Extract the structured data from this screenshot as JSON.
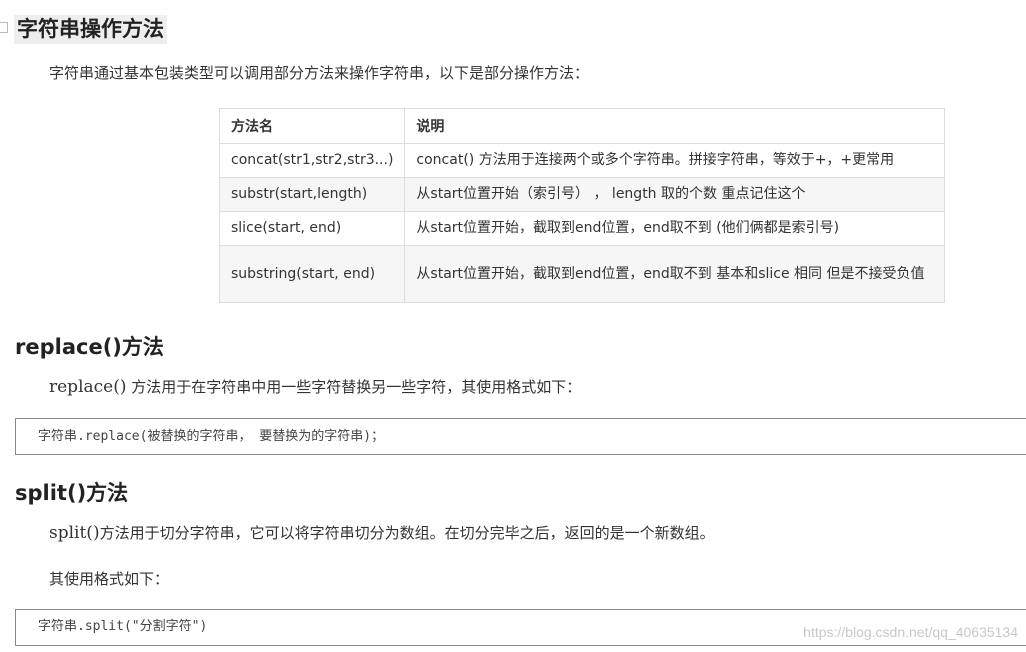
{
  "section_title": "字符串操作方法",
  "intro": "字符串通过基本包装类型可以调用部分方法来操作字符串，以下是部分操作方法：",
  "table": {
    "headers": [
      "方法名",
      "说明"
    ],
    "rows": [
      [
        "concat(str1,str2,str3...)",
        "concat() 方法用于连接两个或多个字符串。拼接字符串，等效于+，+更常用"
      ],
      [
        "substr(start,length)",
        "从start位置开始（索引号）  ，  length  取的个数   重点记住这个"
      ],
      [
        "slice(start, end)",
        "从start位置开始，截取到end位置，end取不到 (他们俩都是索引号)"
      ],
      [
        "substring(start, end)",
        "从start位置开始，截取到end位置，end取不到    基本和slice 相同 但是不接受负值"
      ]
    ]
  },
  "replace_section": {
    "title": "replace()方法",
    "desc_code": "replace()",
    "desc_text": " 方法用于在字符串中用一些字符替换另一些字符，其使用格式如下：",
    "code": "字符串.replace(被替换的字符串， 要替换为的字符串)；"
  },
  "split_section": {
    "title": "split()方法",
    "desc_code": "split()",
    "desc_text": "方法用于切分字符串，它可以将字符串切分为数组。在切分完毕之后，返回的是一个新数组。",
    "usage": "其使用格式如下：",
    "code": "字符串.split(\"分割字符\")"
  },
  "watermark": "https://blog.csdn.net/qq_40635134"
}
